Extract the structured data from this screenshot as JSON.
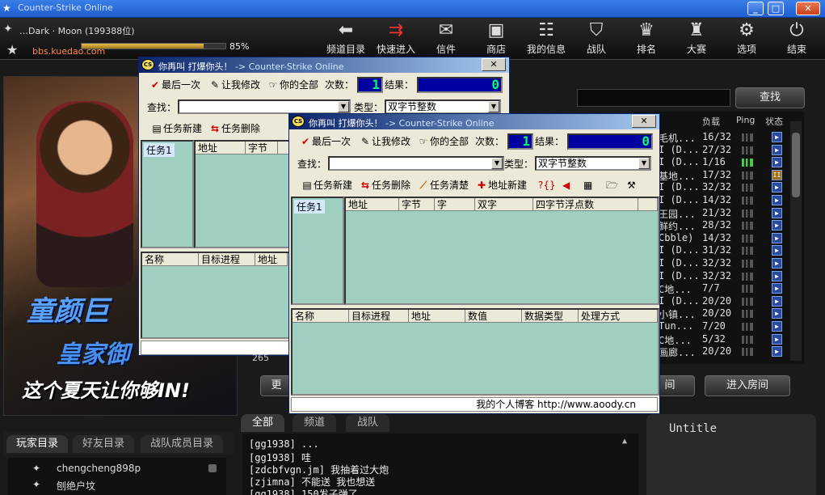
{
  "window": {
    "title": "Counter-Strike Online",
    "min": "_",
    "max": "□",
    "close": "✕"
  },
  "user": {
    "line": "…Dark · Moon (199388位)",
    "exp_percent": 85,
    "exp_label": "85%",
    "site": "bbs.kuedao.com"
  },
  "nav": [
    {
      "label": "频道目录",
      "icon": "⬅"
    },
    {
      "label": "快速进入",
      "icon": "⇉"
    },
    {
      "label": "信件",
      "icon": "✉"
    },
    {
      "label": "商店",
      "icon": "▣"
    },
    {
      "label": "我的信息",
      "icon": "☷"
    },
    {
      "label": "战队",
      "icon": "⛉"
    },
    {
      "label": "排名",
      "icon": "♛"
    },
    {
      "label": "大赛",
      "icon": "♜"
    },
    {
      "label": "选项",
      "icon": "⚙"
    },
    {
      "label": "结束",
      "icon": "⏻"
    }
  ],
  "promo": {
    "line1": "童颜巨",
    "line2": "皇家御",
    "line3": "这个夏天让你够IN!"
  },
  "left_tabs": [
    "玩家目录",
    "好友目录",
    "战队成员目录"
  ],
  "players": [
    "chengcheng898p",
    "刨绝户坟"
  ],
  "search_btn": "查找",
  "rooms": {
    "headers": {
      "load": "负载",
      "ping": "Ping",
      "state": "状态"
    },
    "rows": [
      {
        "name": "毛机...",
        "count": "16/32"
      },
      {
        "name": "I (D...",
        "count": "27/32"
      },
      {
        "name": "I (D...",
        "count": "1/16"
      },
      {
        "name": "基地...",
        "count": "17/32"
      },
      {
        "name": "I (D...",
        "count": "32/32"
      },
      {
        "name": "I (D...",
        "count": "14/32"
      },
      {
        "name": "王园...",
        "count": "21/32"
      },
      {
        "name": "鲜约...",
        "count": "28/32"
      },
      {
        "name": "Cbble)",
        "count": "14/32"
      },
      {
        "name": "I (D...",
        "count": "31/32"
      },
      {
        "name": "I (D...",
        "count": "32/32"
      },
      {
        "name": "I (D...",
        "count": "32/32"
      },
      {
        "name": "C地...",
        "count": "7/7"
      },
      {
        "name": "I (D...",
        "count": "20/20"
      },
      {
        "name": "小镇...",
        "count": "20/20"
      },
      {
        "name": "Tun...",
        "count": "7/20"
      },
      {
        "name": "C地...",
        "count": "5/32"
      },
      {
        "name": "画廊...",
        "count": "20/20"
      }
    ]
  },
  "room_btns": {
    "left": "间",
    "enter": "进入房间",
    "more": "更"
  },
  "chat_tabs": [
    "全部",
    "频道",
    "战队"
  ],
  "chat": [
    "[gg1938] ...",
    "[gg1938] 哇",
    "[zdcbfvgn.jm] 我抽着过大炮",
    "[zjimna] 不能送 我也想送",
    "[gg1938] 150发子弹了"
  ],
  "untitle": "Untitle",
  "tool": {
    "logo": "CS",
    "title": "你再叫 打爆你头！",
    "title2": "->  Counter-Strike Online",
    "close": "✕",
    "btn_last": "最后一次",
    "btn_modify": "让我修改",
    "btn_all": "你的全部",
    "count_label": "次数：",
    "count_value": "1",
    "result_label": "结果：",
    "result_value": "0",
    "find_label": "查找：",
    "type_label": "类型：",
    "type_value": "双字节整数",
    "task_new": "任务新建",
    "task_del": "任务删除",
    "task_clear": "任务清楚",
    "addr_new": "地址新建",
    "task_item": "任务1",
    "cols_top": [
      "地址",
      "字节",
      "字",
      "双字",
      "四字节浮点数"
    ],
    "cols_bottom": [
      "名称",
      "目标进程",
      "地址",
      "数值",
      "数据类型",
      "处理方式"
    ],
    "status": "我的个人博客 http://www.aoody.cn",
    "back_fragment": "265"
  }
}
